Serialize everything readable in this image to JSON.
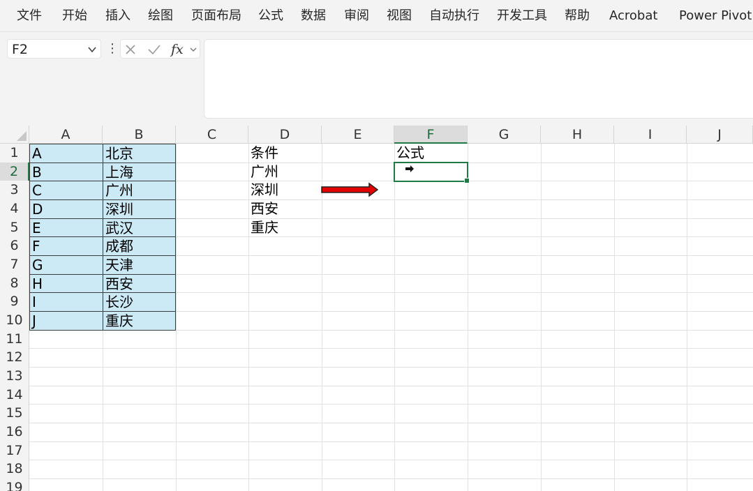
{
  "ribbon": {
    "tabs": [
      "文件",
      "开始",
      "插入",
      "绘图",
      "页面布局",
      "公式",
      "数据",
      "审阅",
      "视图",
      "自动执行",
      "开发工具",
      "帮助",
      "Acrobat",
      "Power Pivot"
    ]
  },
  "formula_bar": {
    "name_box": "F2",
    "fx_label": "fx",
    "formula": ""
  },
  "sheet": {
    "columns": [
      "A",
      "B",
      "C",
      "D",
      "E",
      "F",
      "G",
      "H",
      "I",
      "J"
    ],
    "active_column": "F",
    "rows": [
      "1",
      "2",
      "3",
      "4",
      "5",
      "6",
      "7",
      "8",
      "9",
      "10",
      "11",
      "12",
      "13",
      "14",
      "15",
      "16",
      "17",
      "18",
      "19"
    ],
    "active_row": "2",
    "table_a": [
      "A",
      "B",
      "C",
      "D",
      "E",
      "F",
      "G",
      "H",
      "I",
      "J"
    ],
    "table_b": [
      "北京",
      "上海",
      "广州",
      "深圳",
      "武汉",
      "成都",
      "天津",
      "西安",
      "长沙",
      "重庆"
    ],
    "col_d": [
      "条件",
      "广州",
      "深圳",
      "西安",
      "重庆"
    ],
    "f1": "公式",
    "arrow_color": "#e00000",
    "fill_color": "#cce9f6",
    "accent": "#1f7a45"
  }
}
